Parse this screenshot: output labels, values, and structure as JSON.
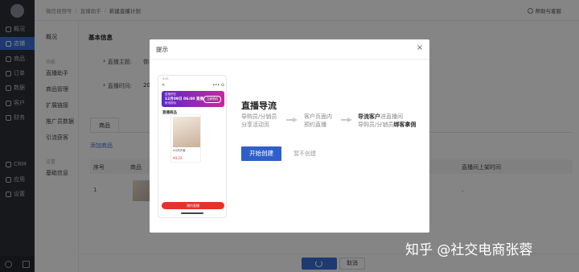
{
  "header": {
    "breadcrumb": [
      "微信视频号",
      "直播助手",
      "新建直播计划"
    ],
    "help_label": "帮助与客服"
  },
  "nav": {
    "items": [
      "概况",
      "店铺",
      "商品",
      "订单",
      "数据",
      "客户",
      "财务",
      "CRM",
      "应用",
      "设置"
    ],
    "active_index": 1
  },
  "submenu": {
    "overview": "概况",
    "group_label": "功能",
    "items": [
      "直播助手",
      "商品管理",
      "扩展链接",
      "推广员数据",
      "引流获客"
    ],
    "group2_label": "设置",
    "settings_item": "基础信息",
    "active_item": "直播助手"
  },
  "form": {
    "section_title": "基本信息",
    "topic_label": "* 直播主题:",
    "topic_value": "你",
    "time_label": "* 直播时间:",
    "time_value": "20",
    "tab_goods": "商品",
    "add_goods": "添加商品",
    "columns": [
      "序号",
      "商品",
      "直播间上架时间"
    ],
    "row_index": "1",
    "row_time": "-"
  },
  "footer": {
    "cancel_label": "取消"
  },
  "modal": {
    "title": "提示",
    "close_glyph": "×",
    "flow_title": "直播导流",
    "steps": [
      {
        "line1": "导购员/分销员",
        "line2": "分享活动页"
      },
      {
        "line1": "客户页面内",
        "line2": "预约直播"
      },
      {
        "line1_strong": "导流客户",
        "line1_rest": "进直播间",
        "line2_rest": "导购员/分销员",
        "line2_strong": "绑客拿佣"
      }
    ],
    "create_label": "开始创建",
    "skip_label": "暂不创建"
  },
  "phone": {
    "status": "9:41",
    "back": "<",
    "nav_icons": "••• ⊙",
    "banner_line1": "直播预告",
    "banner_line2": "12月09日 06:00 直播",
    "banner_line3": "敬请期待",
    "banner_btn": "立即预约",
    "list_title": "直播商品",
    "product_name": "Ins风外套",
    "product_price": "¥4.23",
    "cta_label": "预约直播"
  },
  "watermark": "知乎 @社交电商张蓉",
  "colors": {
    "accent": "#3b6fd8",
    "primary_button": "#2f5fc9",
    "nav_bg": "#2b2e35",
    "banner_from": "#5b2ac9",
    "banner_to": "#c42a9b",
    "cta": "#e8312a"
  }
}
